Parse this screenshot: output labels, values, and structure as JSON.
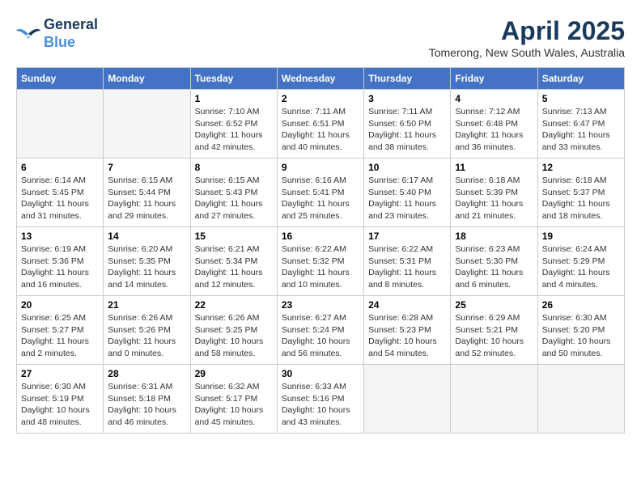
{
  "header": {
    "logo_line1": "General",
    "logo_line2": "Blue",
    "month": "April 2025",
    "location": "Tomerong, New South Wales, Australia"
  },
  "weekdays": [
    "Sunday",
    "Monday",
    "Tuesday",
    "Wednesday",
    "Thursday",
    "Friday",
    "Saturday"
  ],
  "weeks": [
    [
      {
        "day": "",
        "info": ""
      },
      {
        "day": "",
        "info": ""
      },
      {
        "day": "1",
        "info": "Sunrise: 7:10 AM\nSunset: 6:52 PM\nDaylight: 11 hours and 42 minutes."
      },
      {
        "day": "2",
        "info": "Sunrise: 7:11 AM\nSunset: 6:51 PM\nDaylight: 11 hours and 40 minutes."
      },
      {
        "day": "3",
        "info": "Sunrise: 7:11 AM\nSunset: 6:50 PM\nDaylight: 11 hours and 38 minutes."
      },
      {
        "day": "4",
        "info": "Sunrise: 7:12 AM\nSunset: 6:48 PM\nDaylight: 11 hours and 36 minutes."
      },
      {
        "day": "5",
        "info": "Sunrise: 7:13 AM\nSunset: 6:47 PM\nDaylight: 11 hours and 33 minutes."
      }
    ],
    [
      {
        "day": "6",
        "info": "Sunrise: 6:14 AM\nSunset: 5:45 PM\nDaylight: 11 hours and 31 minutes."
      },
      {
        "day": "7",
        "info": "Sunrise: 6:15 AM\nSunset: 5:44 PM\nDaylight: 11 hours and 29 minutes."
      },
      {
        "day": "8",
        "info": "Sunrise: 6:15 AM\nSunset: 5:43 PM\nDaylight: 11 hours and 27 minutes."
      },
      {
        "day": "9",
        "info": "Sunrise: 6:16 AM\nSunset: 5:41 PM\nDaylight: 11 hours and 25 minutes."
      },
      {
        "day": "10",
        "info": "Sunrise: 6:17 AM\nSunset: 5:40 PM\nDaylight: 11 hours and 23 minutes."
      },
      {
        "day": "11",
        "info": "Sunrise: 6:18 AM\nSunset: 5:39 PM\nDaylight: 11 hours and 21 minutes."
      },
      {
        "day": "12",
        "info": "Sunrise: 6:18 AM\nSunset: 5:37 PM\nDaylight: 11 hours and 18 minutes."
      }
    ],
    [
      {
        "day": "13",
        "info": "Sunrise: 6:19 AM\nSunset: 5:36 PM\nDaylight: 11 hours and 16 minutes."
      },
      {
        "day": "14",
        "info": "Sunrise: 6:20 AM\nSunset: 5:35 PM\nDaylight: 11 hours and 14 minutes."
      },
      {
        "day": "15",
        "info": "Sunrise: 6:21 AM\nSunset: 5:34 PM\nDaylight: 11 hours and 12 minutes."
      },
      {
        "day": "16",
        "info": "Sunrise: 6:22 AM\nSunset: 5:32 PM\nDaylight: 11 hours and 10 minutes."
      },
      {
        "day": "17",
        "info": "Sunrise: 6:22 AM\nSunset: 5:31 PM\nDaylight: 11 hours and 8 minutes."
      },
      {
        "day": "18",
        "info": "Sunrise: 6:23 AM\nSunset: 5:30 PM\nDaylight: 11 hours and 6 minutes."
      },
      {
        "day": "19",
        "info": "Sunrise: 6:24 AM\nSunset: 5:29 PM\nDaylight: 11 hours and 4 minutes."
      }
    ],
    [
      {
        "day": "20",
        "info": "Sunrise: 6:25 AM\nSunset: 5:27 PM\nDaylight: 11 hours and 2 minutes."
      },
      {
        "day": "21",
        "info": "Sunrise: 6:26 AM\nSunset: 5:26 PM\nDaylight: 11 hours and 0 minutes."
      },
      {
        "day": "22",
        "info": "Sunrise: 6:26 AM\nSunset: 5:25 PM\nDaylight: 10 hours and 58 minutes."
      },
      {
        "day": "23",
        "info": "Sunrise: 6:27 AM\nSunset: 5:24 PM\nDaylight: 10 hours and 56 minutes."
      },
      {
        "day": "24",
        "info": "Sunrise: 6:28 AM\nSunset: 5:23 PM\nDaylight: 10 hours and 54 minutes."
      },
      {
        "day": "25",
        "info": "Sunrise: 6:29 AM\nSunset: 5:21 PM\nDaylight: 10 hours and 52 minutes."
      },
      {
        "day": "26",
        "info": "Sunrise: 6:30 AM\nSunset: 5:20 PM\nDaylight: 10 hours and 50 minutes."
      }
    ],
    [
      {
        "day": "27",
        "info": "Sunrise: 6:30 AM\nSunset: 5:19 PM\nDaylight: 10 hours and 48 minutes."
      },
      {
        "day": "28",
        "info": "Sunrise: 6:31 AM\nSunset: 5:18 PM\nDaylight: 10 hours and 46 minutes."
      },
      {
        "day": "29",
        "info": "Sunrise: 6:32 AM\nSunset: 5:17 PM\nDaylight: 10 hours and 45 minutes."
      },
      {
        "day": "30",
        "info": "Sunrise: 6:33 AM\nSunset: 5:16 PM\nDaylight: 10 hours and 43 minutes."
      },
      {
        "day": "",
        "info": ""
      },
      {
        "day": "",
        "info": ""
      },
      {
        "day": "",
        "info": ""
      }
    ]
  ]
}
